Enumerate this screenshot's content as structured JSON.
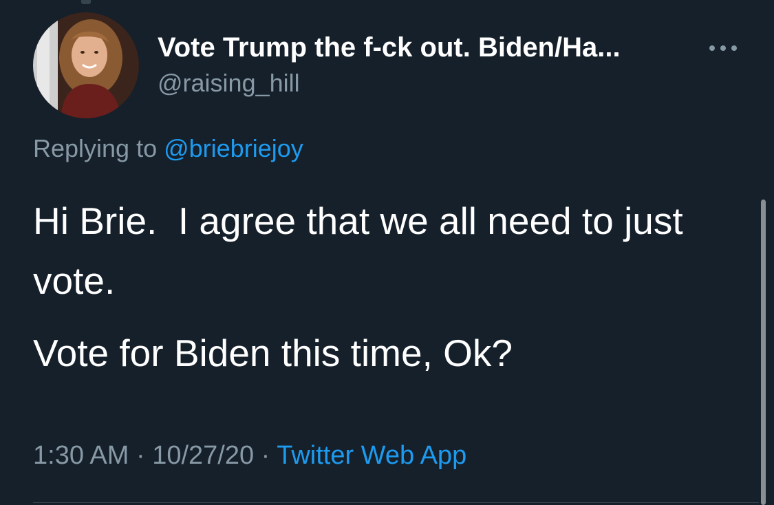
{
  "tweet": {
    "author": {
      "display_name": "Vote Trump the f-ck out. Biden/Ha...",
      "handle": "@raising_hill",
      "avatar_icon": "profile-photo"
    },
    "more_icon": "ellipsis-icon",
    "replying_prefix": "Replying to ",
    "replying_to": "@briebriejoy",
    "paragraphs": [
      "Hi Brie.  I agree that we all need to just vote.",
      "Vote for Biden this time, Ok?"
    ],
    "time": "1:30 AM",
    "separator": " · ",
    "date": "10/27/20",
    "source": "Twitter Web App"
  },
  "colors": {
    "background": "#15202b",
    "text": "#ffffff",
    "secondary_text": "#8899a6",
    "link": "#1d9bf0"
  }
}
